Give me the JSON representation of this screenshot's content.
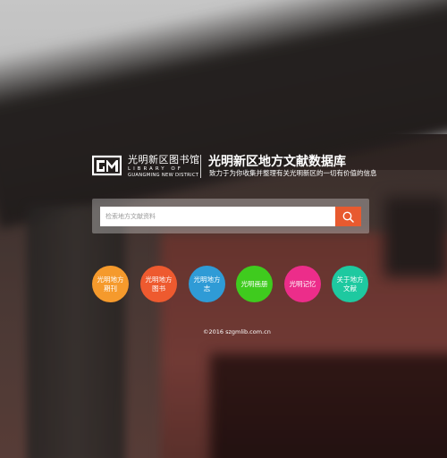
{
  "header": {
    "logo_cn": "光明新区图书馆",
    "logo_en_line1": "LIBRARY OF",
    "logo_en_line2": "GUANGMING NEW DISTRICT",
    "title": "光明新区地方文献数据库",
    "subtitle": "致力于为你收集并整理有关光明新区的一切有价值的信息"
  },
  "search": {
    "placeholder": "检索地方文献资料",
    "button_icon": "search-icon",
    "button_color": "#e85a2f"
  },
  "categories": [
    {
      "label": "光明地方期刊",
      "color": "#f59a2c"
    },
    {
      "label": "光明地方图书",
      "color": "#ee5a2f"
    },
    {
      "label": "光明地方志",
      "color": "#2f9bd6"
    },
    {
      "label": "光明画册",
      "color": "#3fcb1e"
    },
    {
      "label": "光明记忆",
      "color": "#ec2d8a"
    },
    {
      "label": "关于地方文献",
      "color": "#1ec9a0"
    }
  ],
  "footer": {
    "copyright": "©2016 szgmlib.com.cn"
  }
}
